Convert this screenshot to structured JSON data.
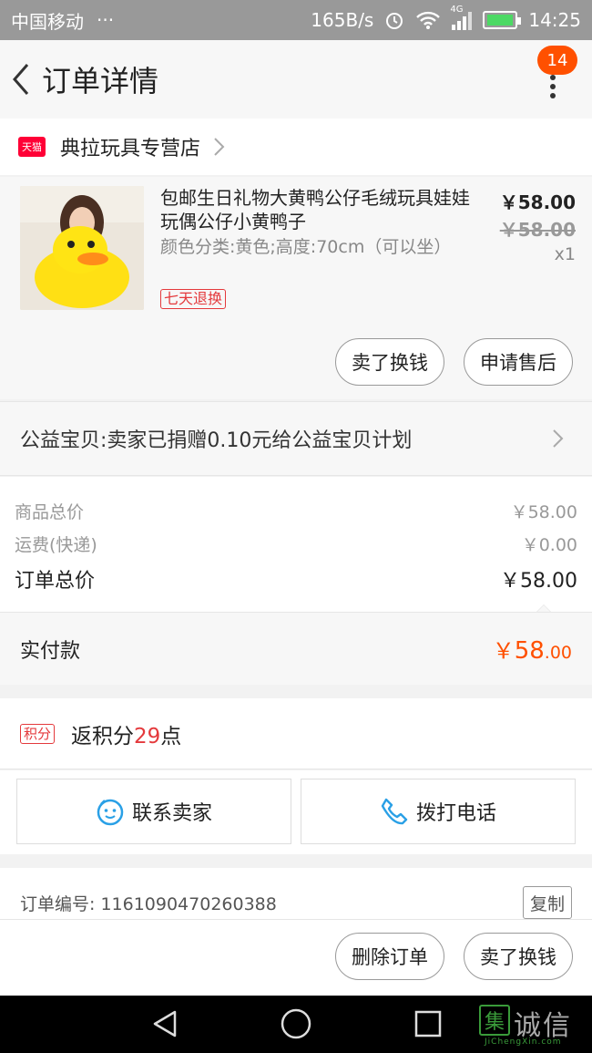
{
  "status_bar": {
    "carrier": "中国移动",
    "dots": "···",
    "speed": "165B/s",
    "network": "4G",
    "time": "14:25"
  },
  "nav": {
    "title": "订单详情",
    "badge_count": "14"
  },
  "store": {
    "platform_tag": "天猫",
    "name": "典拉玩具专营店"
  },
  "item": {
    "title": "包邮生日礼物大黄鸭公仔毛绒玩具娃娃玩偶公仔小黄鸭子",
    "spec": "颜色分类:黄色;高度:70cm（可以坐）",
    "return_tag": "七天退换",
    "price": "￥58.00",
    "original_price": "￥58.00",
    "quantity": "x1",
    "sell_button": "卖了换钱",
    "after_sale_button": "申请售后"
  },
  "charity": {
    "text": "公益宝贝:卖家已捐赠0.10元给公益宝贝计划"
  },
  "summary": {
    "goods_label": "商品总价",
    "goods_value": "￥58.00",
    "shipping_label": "运费(快递)",
    "shipping_value": "￥0.00",
    "total_label": "订单总价",
    "total_value": "￥58.00"
  },
  "paid": {
    "label": "实付款",
    "currency": "￥",
    "integer": "58",
    "decimal": ".00"
  },
  "points": {
    "tag": "积分",
    "prefix": "返积分",
    "count": "29",
    "suffix": "点"
  },
  "contact": {
    "seller_label": "联系卖家",
    "phone_label": "拨打电话"
  },
  "order": {
    "number_text": "订单编号: 1161090470260388",
    "copy_label": "复制"
  },
  "bottom_actions": {
    "delete_label": "删除订单",
    "sell_label": "卖了换钱"
  },
  "watermark": {
    "logo_char": "集",
    "text": "诚信",
    "url": "JiChengXin.com"
  },
  "colors": {
    "accent": "#ff5000",
    "tmall_red": "#ff0036",
    "tag_red": "#e4393c",
    "icon_blue": "#2aa0e6"
  }
}
